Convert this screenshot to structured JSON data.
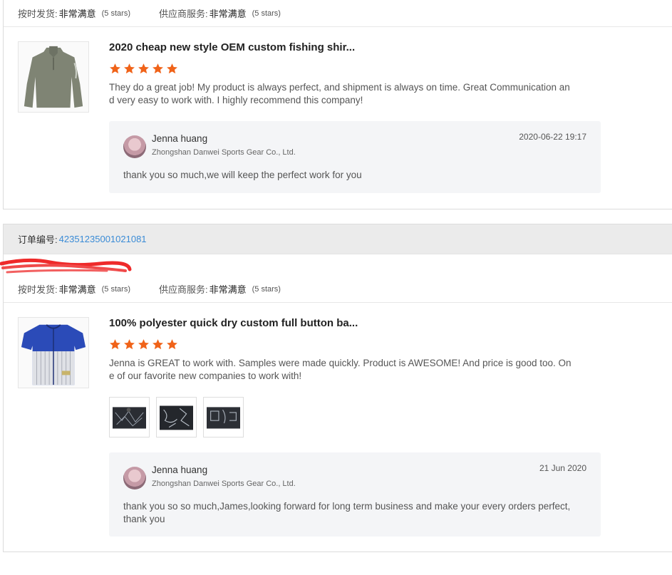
{
  "colors": {
    "accent_link": "#3a8bd6",
    "star": "#f06319",
    "reply_bg": "#f4f5f7"
  },
  "icons": {
    "star": "star-icon",
    "avatar": "avatar"
  },
  "reviews": [
    {
      "order_label": "",
      "order_number": "",
      "ontime_label": "按时发货:",
      "ontime_value": "非常满意",
      "ontime_stars": "(5 stars)",
      "service_label": "供应商服务:",
      "service_value": "非常满意",
      "service_stars": "(5 stars)",
      "product_title": "2020 cheap new style OEM custom fishing shir...",
      "rating": 5,
      "comment": "They do a great job! My product is always perfect, and shipment is always on time. Great Communication and very easy to work with. I highly recommend this company!",
      "reply": {
        "name": "Jenna huang",
        "company": "Zhongshan Danwei Sports Gear Co., Ltd.",
        "date": "2020-06-22 19:17",
        "text": "thank you so much,we will keep the perfect work for you"
      }
    },
    {
      "order_label": "订单编号:",
      "order_number": "42351235001021081",
      "ontime_label": "按时发货:",
      "ontime_value": "非常满意",
      "ontime_stars": "(5 stars)",
      "service_label": "供应商服务:",
      "service_value": "非常满意",
      "service_stars": "(5 stars)",
      "product_title": "100% polyester quick dry custom full button ba...",
      "rating": 5,
      "comment": "Jenna is GREAT to work with. Samples were made quickly. Product is AWESOME! And price is good too. One of our favorite new companies to work with!",
      "photo_count": 3,
      "reply": {
        "name": "Jenna huang",
        "company": "Zhongshan Danwei Sports Gear Co., Ltd.",
        "date": "21 Jun 2020",
        "text": "thank you so so much,James,looking forward for long term business and make your every orders perfect, thank you"
      }
    }
  ]
}
